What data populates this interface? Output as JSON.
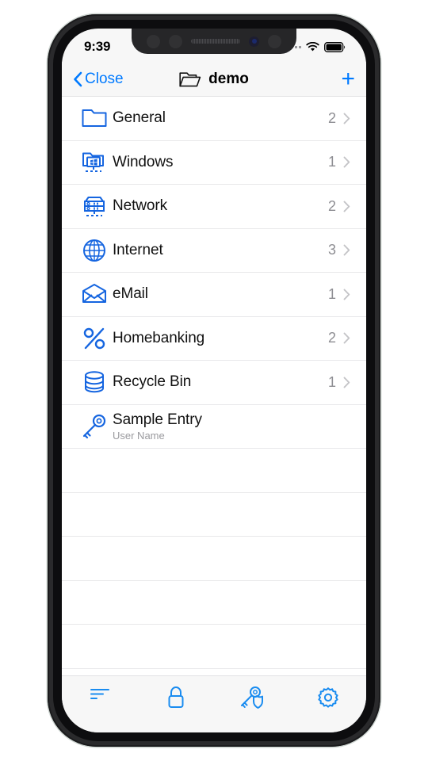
{
  "status": {
    "time": "9:39",
    "cellular": "cellular-dots",
    "wifi": "wifi-icon",
    "battery": "battery-full-icon"
  },
  "nav": {
    "back_label": "Close",
    "title": "demo",
    "add_label": "+",
    "folder_icon": "folder-icon"
  },
  "list": [
    {
      "icon": "folder-icon",
      "title": "General",
      "sub": "",
      "count": "2",
      "chevron": "›"
    },
    {
      "icon": "windows-folder-icon",
      "title": "Windows",
      "sub": "",
      "count": "1",
      "chevron": "›"
    },
    {
      "icon": "server-icon",
      "title": "Network",
      "sub": "",
      "count": "2",
      "chevron": "›"
    },
    {
      "icon": "globe-icon",
      "title": "Internet",
      "sub": "",
      "count": "3",
      "chevron": "›"
    },
    {
      "icon": "envelope-icon",
      "title": "eMail",
      "sub": "",
      "count": "1",
      "chevron": "›"
    },
    {
      "icon": "percent-icon",
      "title": "Homebanking",
      "sub": "",
      "count": "2",
      "chevron": "›"
    },
    {
      "icon": "database-icon",
      "title": "Recycle Bin",
      "sub": "",
      "count": "1",
      "chevron": "›"
    },
    {
      "icon": "key-icon",
      "title": "Sample Entry",
      "sub": "User Name",
      "count": "",
      "chevron": ""
    }
  ],
  "toolbar": [
    {
      "icon": "sort-lines-icon"
    },
    {
      "icon": "lock-icon"
    },
    {
      "icon": "key-shield-icon"
    },
    {
      "icon": "gear-icon"
    }
  ],
  "colors": {
    "accent": "#007AFF",
    "icon_blue": "#1565E0",
    "toolbar_blue": "#1a8cf0",
    "count_gray": "#8e8e93"
  }
}
